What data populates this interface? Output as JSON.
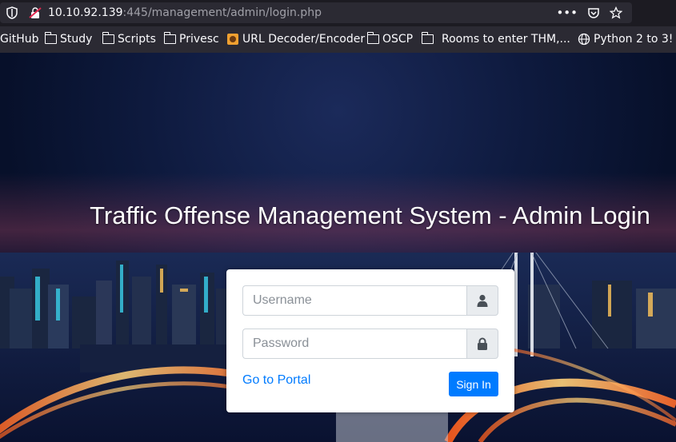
{
  "browser": {
    "url_host": "10.10.92.139",
    "url_rest": ":445/management/admin/login.php",
    "icons": [
      "shield-icon",
      "insecure-lock-icon",
      "more-icon",
      "pocket-icon",
      "star-icon"
    ],
    "bookmarks": [
      {
        "label": "GitHub",
        "icon": ""
      },
      {
        "label": "Study",
        "icon": "folder-icon"
      },
      {
        "label": "Scripts",
        "icon": "folder-icon"
      },
      {
        "label": "Privesc",
        "icon": "folder-icon"
      },
      {
        "label": "URL Decoder/Encoder",
        "icon": "site-icon"
      },
      {
        "label": "OSCP",
        "icon": "folder-icon"
      },
      {
        "label": "Rooms to enter THM,...",
        "icon": "folder-icon"
      },
      {
        "label": "Python 2 to 3!",
        "icon": "globe-icon"
      }
    ]
  },
  "page": {
    "title": "Traffic Offense Management System - Admin Login"
  },
  "login": {
    "username_placeholder": "Username",
    "username_value": "",
    "password_placeholder": "Password",
    "password_value": "",
    "portal_link": "Go to Portal",
    "signin_label": "Sign In",
    "accent_color": "#007bff"
  }
}
